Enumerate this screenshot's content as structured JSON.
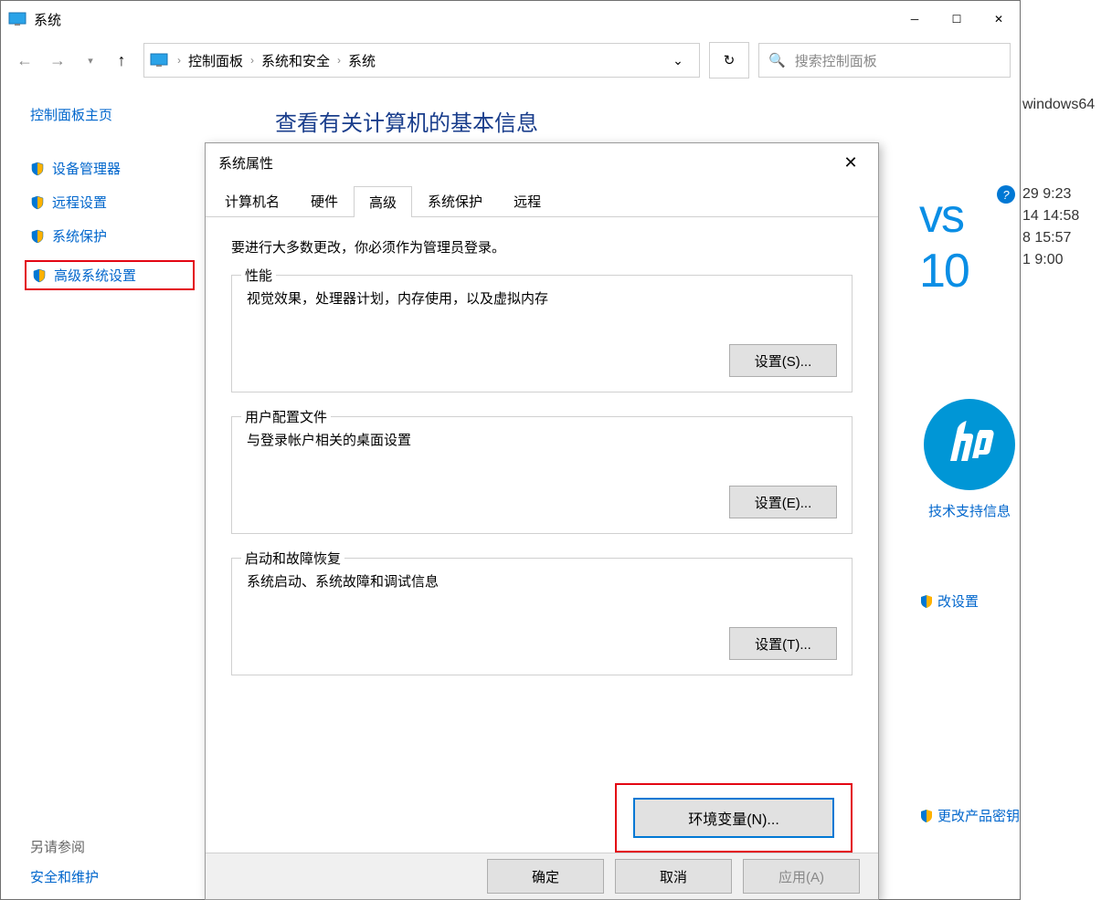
{
  "titlebar": {
    "title": "系统"
  },
  "breadcrumb": {
    "items": [
      "控制面板",
      "系统和安全",
      "系统"
    ]
  },
  "search": {
    "placeholder": "搜索控制面板"
  },
  "sidebar": {
    "home": "控制面板主页",
    "items": [
      "设备管理器",
      "远程设置",
      "系统保护",
      "高级系统设置"
    ],
    "see_also_label": "另请参阅",
    "see_also_items": [
      "安全和维护"
    ]
  },
  "main": {
    "heading": "查看有关计算机的基本信息"
  },
  "right": {
    "windows_label": "vs 10",
    "hp_link": "技术支持信息",
    "change_settings": "改设置",
    "change_key": "更改产品密钥",
    "file_frag": "windows64"
  },
  "extra_times": [
    "29 9:23",
    "14 14:58",
    "8 15:57",
    "1 9:00"
  ],
  "dialog": {
    "title": "系统属性",
    "tabs": [
      "计算机名",
      "硬件",
      "高级",
      "系统保护",
      "远程"
    ],
    "intro": "要进行大多数更改，你必须作为管理员登录。",
    "group_perf": {
      "legend": "性能",
      "desc": "视觉效果，处理器计划，内存使用，以及虚拟内存",
      "btn": "设置(S)..."
    },
    "group_profile": {
      "legend": "用户配置文件",
      "desc": "与登录帐户相关的桌面设置",
      "btn": "设置(E)..."
    },
    "group_startup": {
      "legend": "启动和故障恢复",
      "desc": "系统启动、系统故障和调试信息",
      "btn": "设置(T)..."
    },
    "env_btn": "环境变量(N)...",
    "footer": {
      "ok": "确定",
      "cancel": "取消",
      "apply": "应用(A)"
    }
  }
}
